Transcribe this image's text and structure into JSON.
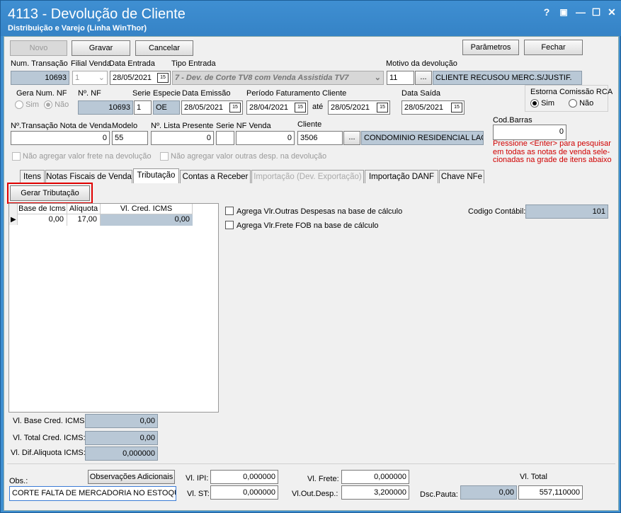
{
  "window": {
    "title": "4113 - Devolução de Cliente",
    "subtitle": "Distribuição e Varejo (Linha WinThor)",
    "help": "?",
    "restore": "▣",
    "minimize": "—",
    "maximize": "☐",
    "close": "✕"
  },
  "toolbar": {
    "novo": "Novo",
    "gravar": "Gravar",
    "cancelar": "Cancelar",
    "parametros": "Parâmetros",
    "fechar": "Fechar"
  },
  "labels": {
    "num_transacao": "Num. Transação",
    "filial_venda": "Filial Venda",
    "data_entrada": "Data Entrada",
    "tipo_entrada": "Tipo Entrada",
    "motivo": "Motivo da devolução",
    "gera_num_nf": "Gera Num. NF",
    "sim": "Sim",
    "nao": "Não",
    "no_nf": "Nº. NF",
    "serie": "Serie",
    "especie": "Especie",
    "data_emissao": "Data Emissão",
    "periodo": "Período Faturamento Cliente",
    "ate": "até",
    "data_saida": "Data Saída",
    "estorna": "Estorna Comissão RCA",
    "transacao_nota": "Nº.Transação Nota de Venda",
    "modelo": "Modelo",
    "lista_presente": "Nº. Lista Presente",
    "serie_nf_venda": "Serie NF Venda",
    "cliente": "Cliente",
    "cod_barras": "Cod.Barras",
    "hint": "Pressione <Enter> para pesquisar em todas as notas de venda sele-cionadas na grade de itens abaixo",
    "nao_agregar_frete": "Não agregar valor frete  na devolução",
    "nao_agregar_outras": "Não agregar valor outras desp. na devolução"
  },
  "fields": {
    "num_transacao": "10693",
    "filial_venda": "1",
    "data_entrada": "28/05/2021",
    "tipo_entrada": "7 - Dev. de Corte TV8 com Venda Assistida TV7",
    "motivo_code": "11",
    "motivo_desc": "CLIENTE RECUSOU MERC.S/JUSTIF.",
    "no_nf": "10693",
    "serie": "1",
    "especie": "OE",
    "data_emissao": "28/05/2021",
    "periodo_de": "28/04/2021",
    "periodo_ate": "28/05/2021",
    "data_saida": "28/05/2021",
    "transacao_nota": "0",
    "modelo": "55",
    "lista_presente": "0",
    "serie_nf_venda": "",
    "serie_nf_venda_num": "0",
    "cliente_code": "3506",
    "cliente_nome": "CONDOMINIO RESIDENCIAL LAGOI",
    "cod_barras": "0"
  },
  "tabs": [
    "Itens",
    "Notas Fiscais de Venda",
    "Tributação",
    "Contas a Receber",
    "Importação (Dev. Exportação)",
    "Importação DANF",
    "Chave NFe"
  ],
  "tributacao": {
    "gerar": "Gerar Tributação",
    "columns": [
      "Base de Icms",
      "Alíquota",
      "Vl. Cred. ICMS"
    ],
    "rows": [
      [
        "0,00",
        "17,00",
        "0,00"
      ]
    ],
    "agrega_outras": "Agrega Vlr.Outras Despesas na base de cálculo",
    "agrega_frete": "Agrega Vlr.Frete FOB na base de cálculo",
    "codigo_contabil_label": "Codigo Contábil:",
    "codigo_contabil": "101",
    "vl_base_label": "Vl. Base Cred. ICMS:",
    "vl_base": "0,00",
    "vl_total_label": "Vl. Total Cred. ICMS:",
    "vl_total": "0,00",
    "vl_dif_label": "Vl. Dif.Aliquota ICMS:",
    "vl_dif": "0,000000"
  },
  "footer": {
    "obs_label": "Obs.:",
    "obs_btn": "Observações Adicionais",
    "obs": "CORTE FALTA DE MERCADORIA NO ESTOQUE",
    "ipi_label": "Vl. IPI:",
    "ipi": "0,000000",
    "st_label": "Vl. ST:",
    "st": "0,000000",
    "frete_label": "Vl. Frete:",
    "frete": "0,000000",
    "outdesp_label": "Vl.Out.Desp.:",
    "outdesp": "3,200000",
    "dsc_label": "Dsc.Pauta:",
    "dsc": "0,00",
    "total_label": "Vl. Total",
    "total": "557,110000"
  }
}
